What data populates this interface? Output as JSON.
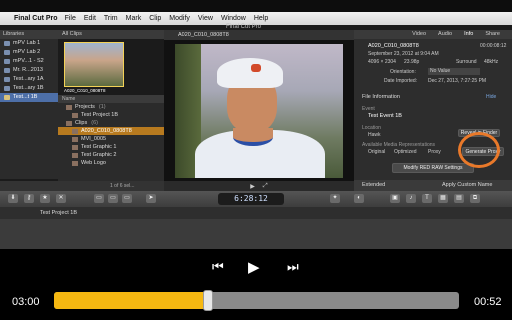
{
  "menubar": {
    "app": "Final Cut Pro",
    "items": [
      "File",
      "Edit",
      "Trim",
      "Mark",
      "Clip",
      "Modify",
      "View",
      "Window",
      "Help"
    ],
    "window_title": "Final Cut Pro"
  },
  "libraries": {
    "header": "Libraries",
    "items": [
      {
        "label": "mPV Lab 1"
      },
      {
        "label": "mPV Lab 2"
      },
      {
        "label": "mPV...1 - S2"
      },
      {
        "label": "Mr. R...2013"
      },
      {
        "label": "Test...ary 1A"
      },
      {
        "label": "Test...ary 1B"
      },
      {
        "label": "Test...t 1B",
        "selected": true
      }
    ]
  },
  "browser": {
    "filter": "All Clips",
    "thumb_label": "A020_C010_0808T8",
    "list_header": "Name",
    "rows": [
      {
        "label": "Projects",
        "count": "(1)"
      },
      {
        "label": "Test Project 1B"
      },
      {
        "label": "Clips",
        "count": "(6)"
      },
      {
        "label": "A020_C010_0808T8",
        "selected": true
      },
      {
        "label": "MVI_0005"
      },
      {
        "label": "Test Graphic 1"
      },
      {
        "label": "Test Graphic 2"
      },
      {
        "label": "Web Logo"
      }
    ],
    "footer": "1 of 6 sel..."
  },
  "viewer": {
    "title": "A020_C010_0808T8"
  },
  "inspector": {
    "tabs": [
      "Video",
      "Audio",
      "Info",
      "Share"
    ],
    "active_tab": "Info",
    "clip_name": "A020_C010_0808T8",
    "duration": "00:00:08:12",
    "date": "September 23, 2012 at 9:04 AM",
    "res": "4096 × 2304",
    "fps": "23.98p",
    "audio": "Surround",
    "rate": "48kHz",
    "orientation_label": "Orientation:",
    "orientation_value": "No Value",
    "imported_label": "Date Imported:",
    "imported_value": "Dec 27, 2013, 7:27:25 PM",
    "section_file_info": "File Information",
    "hide": "Hide",
    "event_label": "Event",
    "event_value": "Test Event 1B",
    "location_label": "Location",
    "location_value": "Hawk",
    "reveal_in_finder": "Reveal in Finder",
    "reps_label": "Available Media Representations",
    "rep_original": "Original",
    "rep_optimized": "Optimized",
    "rep_proxy": "Proxy",
    "generate_proxy": "Generate Proxy",
    "modify_red": "Modify RED RAW Settings",
    "view_mode": "Extended",
    "apply_custom": "Apply Custom Name",
    "accent": "#e9792a"
  },
  "toolbar": {
    "timecode": "6:28:12"
  },
  "timeline": {
    "project_title": "Test Project 1B"
  },
  "player": {
    "elapsed": "03:00",
    "remaining": "00:52",
    "progress": 0.38,
    "fill_color": "#f6b811"
  }
}
